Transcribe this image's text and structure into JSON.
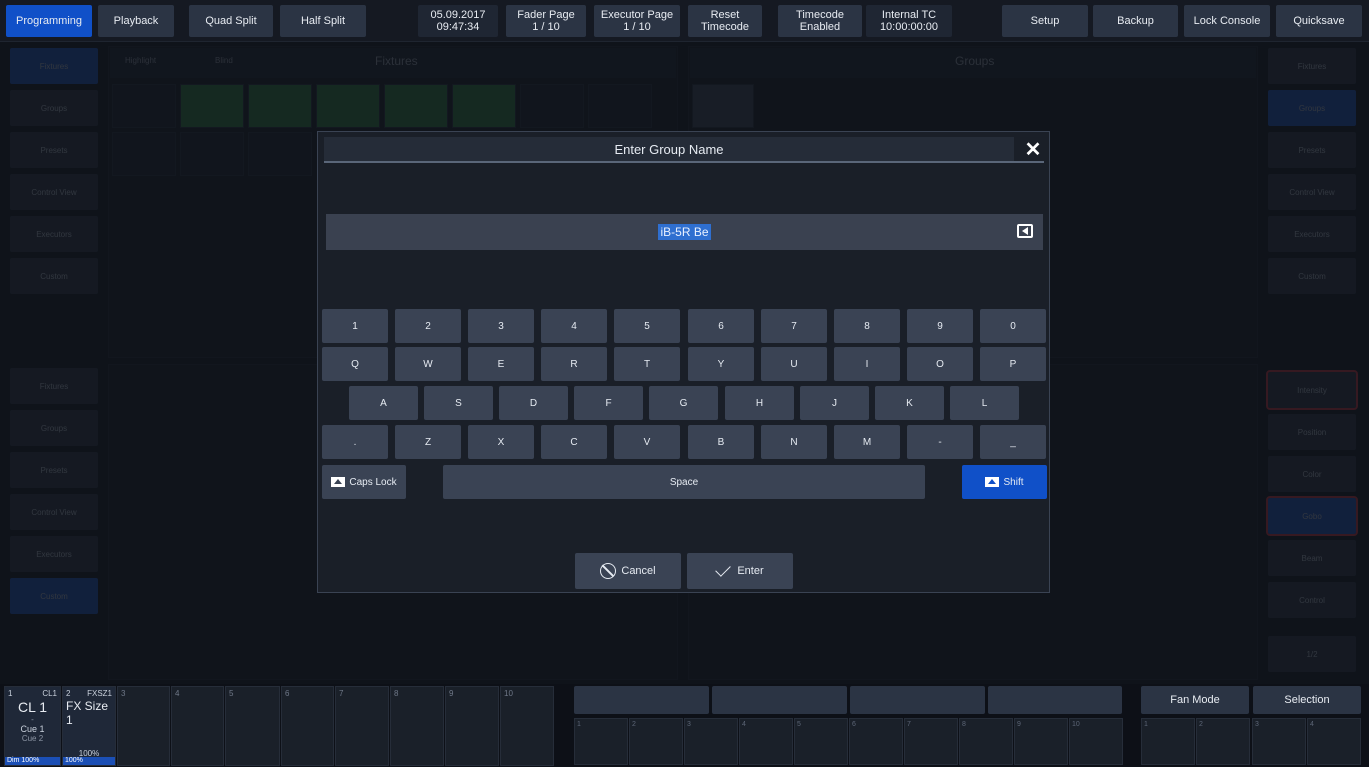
{
  "topbar": {
    "programming": "Programming",
    "playback": "Playback",
    "quad_split": "Quad Split",
    "half_split": "Half Split",
    "date": "05.09.2017",
    "time": "09:47:34",
    "fader_page_label": "Fader Page",
    "fader_page_value": "1 / 10",
    "executor_page_label": "Executor Page",
    "executor_page_value": "1 / 10",
    "reset_label": "Reset",
    "reset_sub": "Timecode",
    "timecode_label": "Timecode",
    "timecode_sub": "Enabled",
    "internal_tc_label": "Internal TC",
    "internal_tc_value": "10:00:00:00",
    "setup": "Setup",
    "backup": "Backup",
    "lock_console": "Lock Console",
    "quicksave": "Quicksave"
  },
  "background": {
    "left_sidebar_top": [
      "Fixtures",
      "Groups",
      "Presets",
      "Control View",
      "Executors",
      "Custom"
    ],
    "left_sidebar_bottom": [
      "Fixtures",
      "Groups",
      "Presets",
      "Control View",
      "Executors",
      "Custom"
    ],
    "right_sidebar_top": [
      "Fixtures",
      "Groups",
      "Presets",
      "Control View",
      "Executors",
      "Custom"
    ],
    "right_sidebar_bottom": [
      "Intensity",
      "Position",
      "Color",
      "Gobo",
      "Beam",
      "Control",
      "1/2"
    ],
    "fixtures_title": "Fixtures",
    "groups_title": "Groups",
    "highlight": "Highlight",
    "blind": "Blind"
  },
  "dialog": {
    "title": "Enter Group Name",
    "input_value": "iB-5R Be",
    "keys_row1": [
      "1",
      "2",
      "3",
      "4",
      "5",
      "6",
      "7",
      "8",
      "9",
      "0"
    ],
    "keys_row2": [
      "Q",
      "W",
      "E",
      "R",
      "T",
      "Y",
      "U",
      "I",
      "O",
      "P"
    ],
    "keys_row3": [
      "A",
      "S",
      "D",
      "F",
      "G",
      "H",
      "J",
      "K",
      "L"
    ],
    "keys_row4": [
      ".",
      "Z",
      "X",
      "C",
      "V",
      "B",
      "N",
      "M",
      "-",
      "_"
    ],
    "caps_lock": "Caps Lock",
    "space": "Space",
    "shift": "Shift",
    "cancel": "Cancel",
    "enter": "Enter"
  },
  "bottom": {
    "exec1_num": "1",
    "exec1_tag": "CL1",
    "exec1_name": "CL 1",
    "exec1_dash": "-",
    "exec1_cue": "Cue 1",
    "exec1_next": "Cue 2",
    "exec1_dim": "Dim 100%",
    "exec2_num": "2",
    "exec2_tag": "FXSZ1",
    "exec2_name": "FX Size 1",
    "exec2_val": "100%",
    "exec2_strip": "100%",
    "exec_numbers": [
      "3",
      "4",
      "5",
      "6",
      "7",
      "8",
      "9",
      "10"
    ],
    "fan_mode": "Fan Mode",
    "selection": "Selection",
    "mid_numbers": [
      "1",
      "2",
      "3",
      "4",
      "5",
      "6",
      "7",
      "8",
      "9",
      "10"
    ],
    "right_numbers": [
      "1",
      "2",
      "3",
      "4"
    ]
  }
}
